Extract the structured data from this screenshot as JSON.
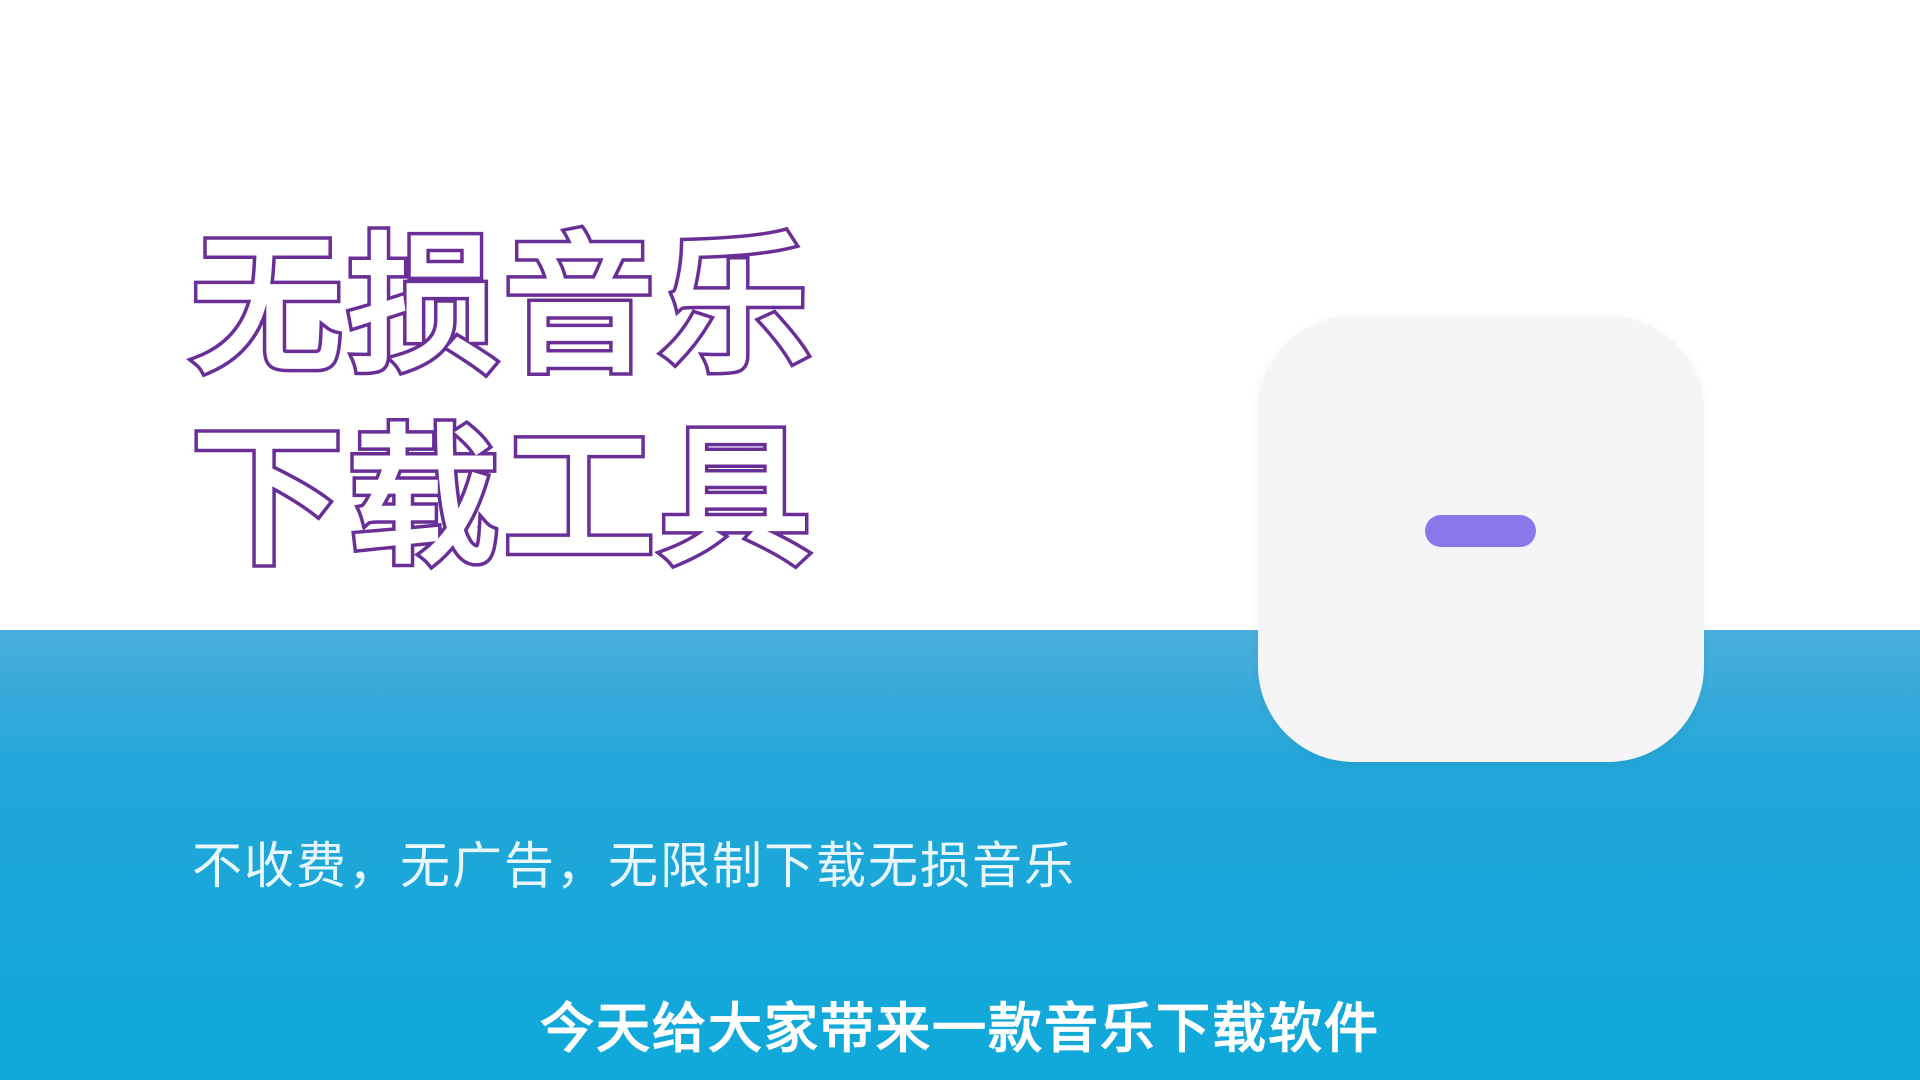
{
  "headline": {
    "line1": "无损音乐",
    "line2": "下载工具"
  },
  "tagline": "不收费，无广告，无限制下载无损音乐",
  "subtitle": "今天给大家带来一款音乐下载软件",
  "app_icon": {
    "icon": "soundwave-icon",
    "colors": {
      "background": "#f5f5f7",
      "bar_top": "#7c6ae6",
      "bar_bottom": "#a896f2"
    }
  },
  "colors": {
    "headline_outline": "#6a2f97",
    "headline_fill": "#ffffff",
    "band": "#22a6d8"
  }
}
